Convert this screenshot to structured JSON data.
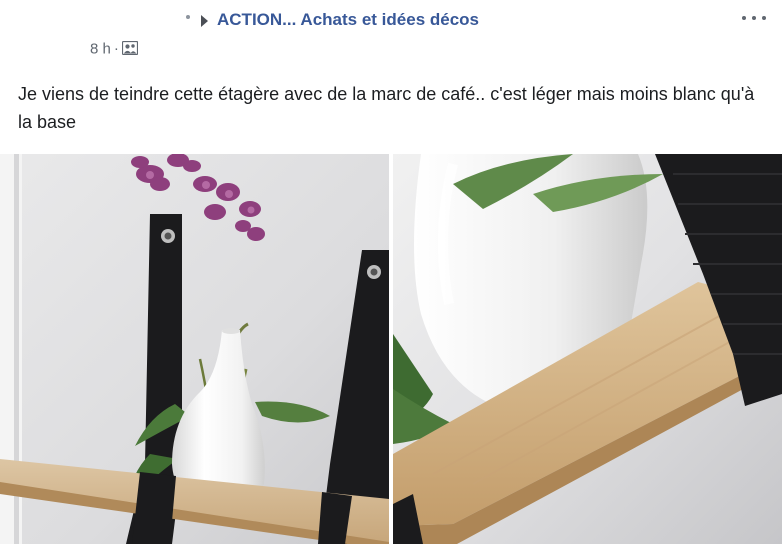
{
  "post": {
    "group_name": "ACTION... Achats et idées décos",
    "timestamp": "8 h",
    "separator": "·",
    "audience_icon": "group-audience-icon",
    "more_icon": "more-options-icon",
    "text": "Je viens de teindre cette étagère avec de la marc de café.. c'est léger mais moins blanc qu'à la base"
  },
  "photos": [
    {
      "subject": "left-shelf-photo",
      "description_icon": "photo-icon"
    },
    {
      "subject": "right-shelf-photo",
      "description_icon": "photo-icon"
    }
  ],
  "colors": {
    "link": "#385898",
    "text": "#1c1e21",
    "meta": "#606770"
  }
}
